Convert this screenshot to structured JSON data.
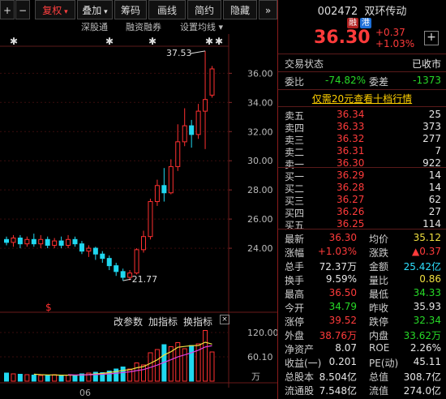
{
  "toolbar": {
    "plus": "+",
    "minus": "−",
    "fuquan": "复权",
    "diejia": "叠加",
    "chouma": "筹码",
    "huaxian": "画线",
    "jianyue": "简约",
    "yincang": "隐藏",
    "more": "»"
  },
  "subbar": {
    "item1": "深股通",
    "item2": "融资融券",
    "item3": "设置均线"
  },
  "chart": {
    "high_label": "37.53",
    "low_label": "21.77",
    "y_ticks": [
      "36.00",
      "34.00",
      "32.00",
      "30.00",
      "28.00",
      "26.00",
      "24.00"
    ],
    "vol_ticks": [
      "120.00",
      "60.10",
      "万"
    ],
    "x_label": "06",
    "dollar": "$",
    "menu": [
      "改参数",
      "加指标",
      "换指标"
    ],
    "candles": [
      {
        "o": 24.6,
        "c": 24.4,
        "h": 24.8,
        "l": 24.2
      },
      {
        "o": 24.4,
        "c": 24.7,
        "h": 24.9,
        "l": 24.1
      },
      {
        "o": 24.7,
        "c": 24.3,
        "h": 24.9,
        "l": 24.0
      },
      {
        "o": 24.3,
        "c": 24.6,
        "h": 24.8,
        "l": 24.1
      },
      {
        "o": 24.6,
        "c": 24.3,
        "h": 25.0,
        "l": 24.1
      },
      {
        "o": 24.3,
        "c": 24.6,
        "h": 24.9,
        "l": 24.0
      },
      {
        "o": 24.6,
        "c": 24.2,
        "h": 24.8,
        "l": 24.0
      },
      {
        "o": 24.2,
        "c": 24.5,
        "h": 24.7,
        "l": 24.0
      },
      {
        "o": 24.5,
        "c": 24.2,
        "h": 24.8,
        "l": 24.0
      },
      {
        "o": 24.2,
        "c": 24.6,
        "h": 24.9,
        "l": 24.0
      },
      {
        "o": 24.6,
        "c": 24.3,
        "h": 24.8,
        "l": 24.1
      },
      {
        "o": 24.3,
        "c": 23.8,
        "h": 24.5,
        "l": 23.6
      },
      {
        "o": 23.8,
        "c": 24.0,
        "h": 24.2,
        "l": 23.4
      },
      {
        "o": 24.0,
        "c": 23.6,
        "h": 24.1,
        "l": 23.2
      },
      {
        "o": 23.6,
        "c": 23.3,
        "h": 23.8,
        "l": 23.0
      },
      {
        "o": 23.3,
        "c": 22.8,
        "h": 23.5,
        "l": 22.5
      },
      {
        "o": 22.8,
        "c": 22.4,
        "h": 23.0,
        "l": 22.1
      },
      {
        "o": 22.4,
        "c": 22.0,
        "h": 22.6,
        "l": 21.77
      },
      {
        "o": 22.0,
        "c": 22.3,
        "h": 22.5,
        "l": 21.8
      },
      {
        "o": 22.3,
        "c": 23.9,
        "h": 24.0,
        "l": 22.2
      },
      {
        "o": 23.9,
        "c": 24.8,
        "h": 25.2,
        "l": 23.7
      },
      {
        "o": 24.8,
        "c": 27.2,
        "h": 27.4,
        "l": 24.6
      },
      {
        "o": 27.2,
        "c": 28.3,
        "h": 28.7,
        "l": 26.9
      },
      {
        "o": 28.3,
        "c": 27.8,
        "h": 29.5,
        "l": 27.2
      },
      {
        "o": 27.8,
        "c": 29.6,
        "h": 30.1,
        "l": 27.7
      },
      {
        "o": 29.6,
        "c": 31.3,
        "h": 32.5,
        "l": 29.3
      },
      {
        "o": 31.3,
        "c": 32.4,
        "h": 33.6,
        "l": 31.0
      },
      {
        "o": 32.4,
        "c": 31.8,
        "h": 32.8,
        "l": 30.9
      },
      {
        "o": 31.8,
        "c": 33.4,
        "h": 33.9,
        "l": 31.5
      },
      {
        "o": 33.4,
        "c": 34.2,
        "h": 37.53,
        "l": 30.8
      },
      {
        "o": 34.5,
        "c": 36.3,
        "h": 36.5,
        "l": 34.33
      }
    ],
    "volumes": [
      {
        "v": 20,
        "up": false
      },
      {
        "v": 18,
        "up": true
      },
      {
        "v": 17,
        "up": false
      },
      {
        "v": 16,
        "up": true
      },
      {
        "v": 15,
        "up": false
      },
      {
        "v": 14,
        "up": true
      },
      {
        "v": 15,
        "up": false
      },
      {
        "v": 16,
        "up": true
      },
      {
        "v": 14,
        "up": false
      },
      {
        "v": 15,
        "up": true
      },
      {
        "v": 14,
        "up": false
      },
      {
        "v": 18,
        "up": false
      },
      {
        "v": 20,
        "up": true
      },
      {
        "v": 22,
        "up": false
      },
      {
        "v": 21,
        "up": false
      },
      {
        "v": 25,
        "up": false
      },
      {
        "v": 30,
        "up": false
      },
      {
        "v": 35,
        "up": false
      },
      {
        "v": 30,
        "up": true
      },
      {
        "v": 45,
        "up": true
      },
      {
        "v": 40,
        "up": true
      },
      {
        "v": 70,
        "up": true
      },
      {
        "v": 78,
        "up": true
      },
      {
        "v": 90,
        "up": false
      },
      {
        "v": 85,
        "up": true
      },
      {
        "v": 95,
        "up": true
      },
      {
        "v": 80,
        "up": true
      },
      {
        "v": 88,
        "up": false
      },
      {
        "v": 92,
        "up": true
      },
      {
        "v": 125,
        "up": true
      },
      {
        "v": 72,
        "up": true
      }
    ]
  },
  "quote": {
    "code": "002472",
    "name": "双环传动",
    "tag1": "融",
    "tag2": "港",
    "price": "36.30",
    "change": "+0.37",
    "pct": "+1.03%",
    "add": "+",
    "trade_status_label": "交易状态",
    "trade_status_value": "已收市",
    "weibi_label": "委比",
    "weibi_value": "-74.82%",
    "weicha_label": "委差",
    "weicha_value": "-1373",
    "promo": "仅需20元查看十档行情",
    "asks": [
      {
        "label": "卖五",
        "price": "36.34",
        "vol": "25"
      },
      {
        "label": "卖四",
        "price": "36.33",
        "vol": "373"
      },
      {
        "label": "卖三",
        "price": "36.32",
        "vol": "277"
      },
      {
        "label": "卖二",
        "price": "36.31",
        "vol": "7"
      },
      {
        "label": "卖一",
        "price": "36.30",
        "vol": "922"
      }
    ],
    "bids": [
      {
        "label": "买一",
        "price": "36.29",
        "vol": "14"
      },
      {
        "label": "买二",
        "price": "36.28",
        "vol": "14"
      },
      {
        "label": "买三",
        "price": "36.27",
        "vol": "62"
      },
      {
        "label": "买四",
        "price": "36.26",
        "vol": "27"
      },
      {
        "label": "买五",
        "price": "36.25",
        "vol": "114"
      }
    ],
    "stats": [
      {
        "l1": "最新",
        "v1": "36.30",
        "c1": "red",
        "l2": "均价",
        "v2": "35.12",
        "c2": "yellow"
      },
      {
        "l1": "涨幅",
        "v1": "+1.03%",
        "c1": "red",
        "l2": "涨跌",
        "v2": "▲0.37",
        "c2": "red"
      },
      {
        "l1": "总手",
        "v1": "72.37万",
        "c1": "white",
        "l2": "金额",
        "v2": "25.42亿",
        "c2": "cyan"
      },
      {
        "l1": "换手",
        "v1": "9.59%",
        "c1": "white",
        "l2": "量比",
        "v2": "0.86",
        "c2": "yellow"
      },
      {
        "l1": "最高",
        "v1": "36.50",
        "c1": "red",
        "l2": "最低",
        "v2": "34.33",
        "c2": "green"
      },
      {
        "l1": "今开",
        "v1": "34.79",
        "c1": "green",
        "l2": "昨收",
        "v2": "35.93",
        "c2": "white"
      },
      {
        "l1": "涨停",
        "v1": "39.52",
        "c1": "red",
        "l2": "跌停",
        "v2": "32.34",
        "c2": "green"
      },
      {
        "l1": "外盘",
        "v1": "38.76万",
        "c1": "red",
        "l2": "内盘",
        "v2": "33.62万",
        "c2": "green"
      },
      {
        "l1": "净资产",
        "v1": "8.07",
        "c1": "white",
        "l2": "ROE",
        "v2": "2.26%",
        "c2": "white"
      },
      {
        "l1": "收益(一)",
        "v1": "0.201",
        "c1": "white",
        "l2": "PE(动)",
        "v2": "45.11",
        "c2": "white"
      },
      {
        "l1": "总股本",
        "v1": "8.504亿",
        "c1": "white",
        "l2": "总值",
        "v2": "308.7亿",
        "c2": "white"
      },
      {
        "l1": "流通股",
        "v1": "7.548亿",
        "c1": "white",
        "l2": "流值",
        "v2": "274.0亿",
        "c2": "white"
      }
    ],
    "info_icon": "ⓘ"
  }
}
